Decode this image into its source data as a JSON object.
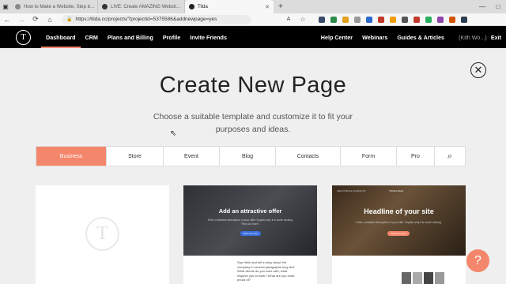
{
  "browser": {
    "tabs": [
      {
        "title": "How to Make a Website, Step b…"
      },
      {
        "title": "LIVE: Create AMAZING Websit…"
      },
      {
        "title": "Tilda"
      }
    ],
    "url": "https://tilda.cc/projects/?projectid=5375586&addnewpage=yes",
    "new_tab": "+",
    "win_min": "—",
    "win_max": "□",
    "back": "←",
    "forward": "→",
    "reload": "⟳",
    "home": "⌂",
    "lock": "🔒",
    "font": "A",
    "star": "☆",
    "extension_colors": [
      "#3a4a6a",
      "#2d8a4a",
      "#e0a020",
      "#999999",
      "#2a6acc",
      "#c0392b",
      "#f39c12",
      "#555555",
      "#c0392b",
      "#27ae60",
      "#8e44ad",
      "#d35400",
      "#2c3e50"
    ]
  },
  "nav": {
    "logo": "T",
    "links": [
      "Dashboard",
      "CRM",
      "Plans and Billing",
      "Profile",
      "Invite Friends"
    ],
    "right_links": [
      "Help Center",
      "Webinars",
      "Guides & Articles"
    ],
    "user": "(Kith Wo...)",
    "exit": "Exit"
  },
  "main": {
    "close": "✕",
    "title": "Create New Page",
    "subtitle": "Choose a suitable template and customize it to fit your purposes and ideas.",
    "categories": [
      "Business",
      "Store",
      "Event",
      "Blog",
      "Contacts",
      "Form",
      "Pro"
    ],
    "search_icon": "⌕",
    "accent": "#f4866b"
  },
  "templates": {
    "blank_logo": "T",
    "card2": {
      "headline": "Add an attractive offer",
      "desc": "Enter a detailed description of your offer. Explain why it is worth clicking \"Find out more\".",
      "button": "Find out more",
      "body": "Say Hello and tell a story about the company in several paragraphs long text. What clients do you work with, what inspires you to work? What are you most proud of?"
    },
    "card3": {
      "nav": "ABOUT  BLOG  CONTACTS",
      "brand": "YOUR LOGO",
      "headline": "Headline of your site",
      "desc": "Enter a detailed description of your offer. Explain why it is worth clicking.",
      "button": "Find out more"
    }
  },
  "help": "?"
}
